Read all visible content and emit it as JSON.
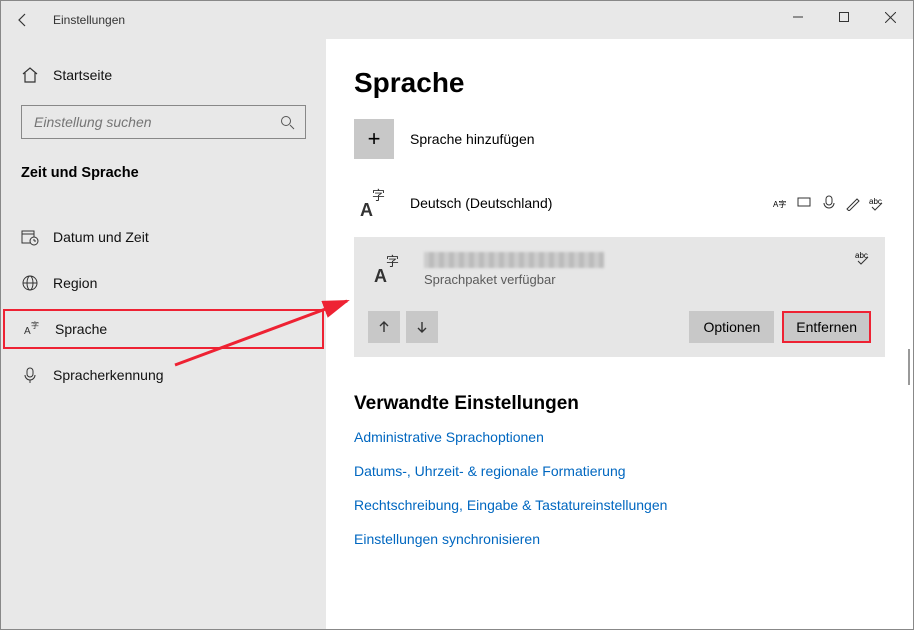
{
  "window": {
    "title": "Einstellungen"
  },
  "sidebar": {
    "home": "Startseite",
    "search_placeholder": "Einstellung suchen",
    "section": "Zeit und Sprache",
    "items": [
      {
        "label": "Datum und Zeit"
      },
      {
        "label": "Region"
      },
      {
        "label": "Sprache"
      },
      {
        "label": "Spracherkennung"
      }
    ]
  },
  "main": {
    "title": "Sprache",
    "add_language": "Sprache hinzufügen",
    "languages": [
      {
        "name": "Deutsch (Deutschland)"
      }
    ],
    "selected": {
      "subtitle": "Sprachpaket verfügbar",
      "options_btn": "Optionen",
      "remove_btn": "Entfernen"
    },
    "related_title": "Verwandte Einstellungen",
    "links": [
      "Administrative Sprachoptionen",
      "Datums-, Uhrzeit- & regionale Formatierung",
      "Rechtschreibung, Eingabe & Tastatureinstellungen",
      "Einstellungen synchronisieren"
    ]
  }
}
